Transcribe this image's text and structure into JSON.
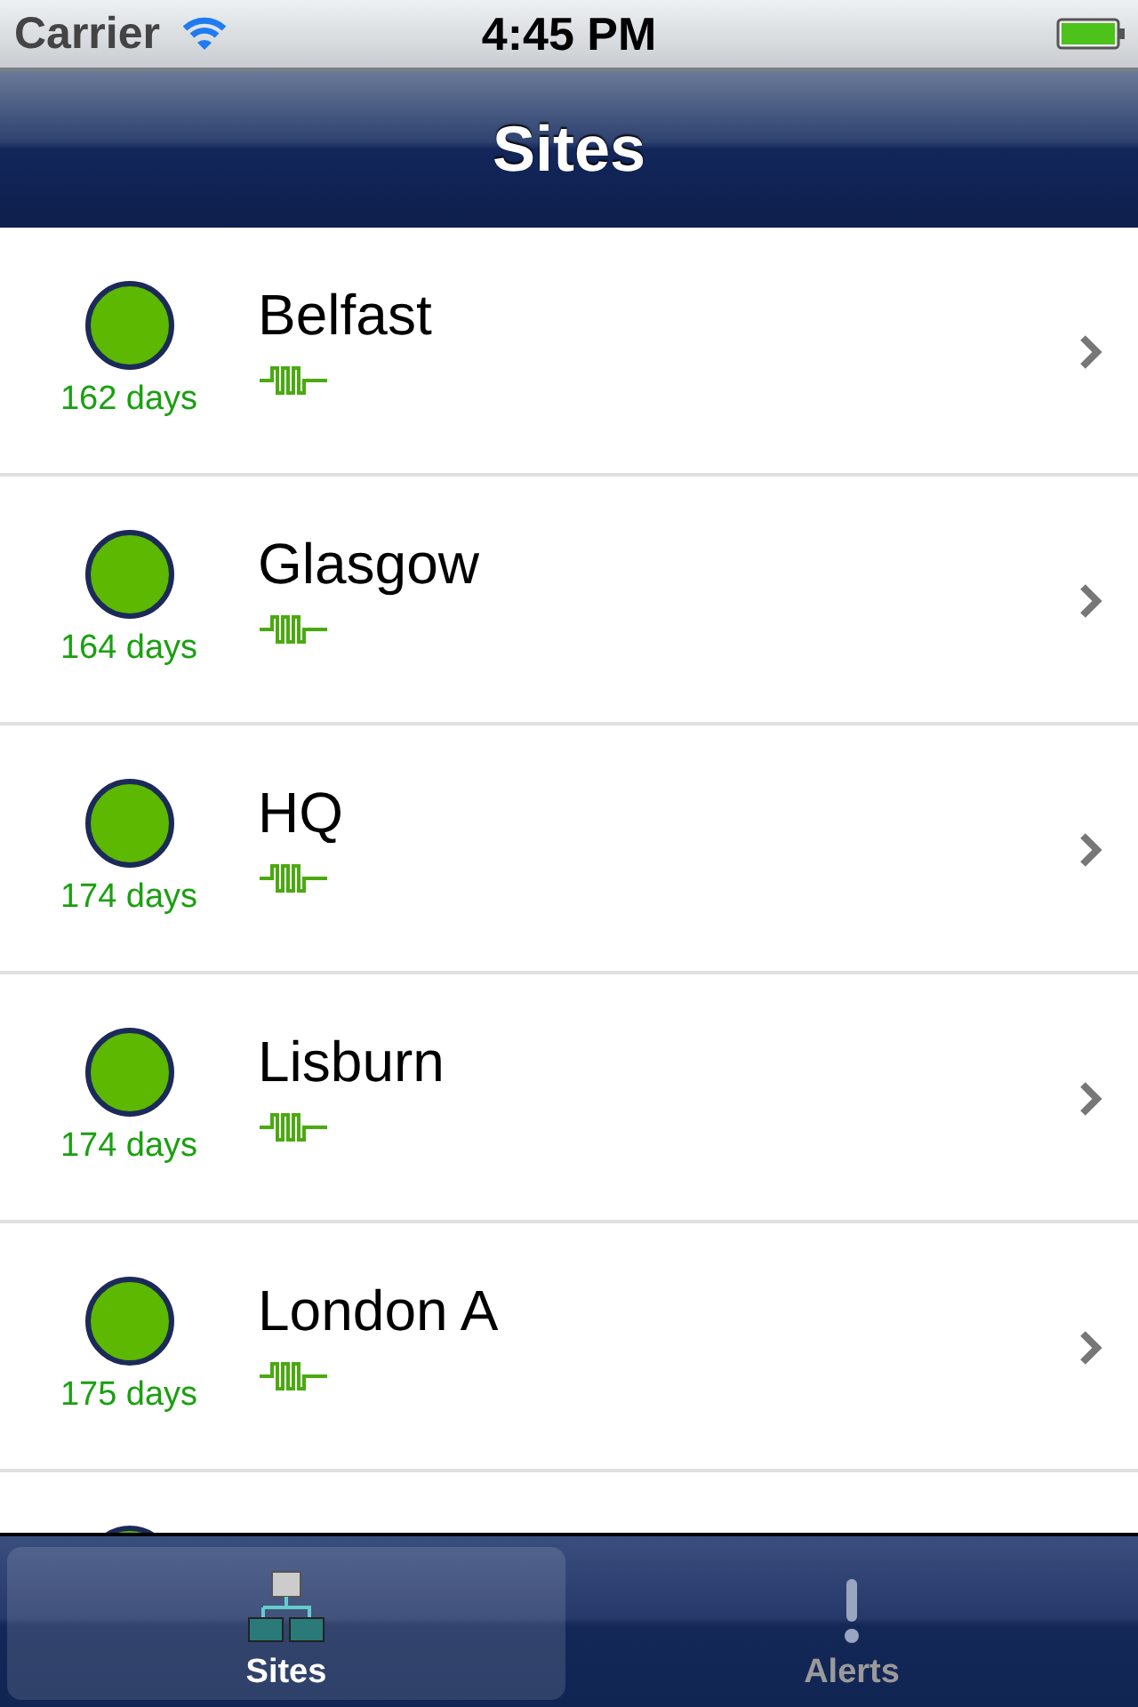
{
  "status_bar": {
    "carrier": "Carrier",
    "time": "4:45 PM"
  },
  "nav_bar": {
    "title": "Sites"
  },
  "sites": [
    {
      "name": "Belfast",
      "uptime": "162 days",
      "color": "#5cb800"
    },
    {
      "name": "Glasgow",
      "uptime": "164 days",
      "color": "#5cb800"
    },
    {
      "name": "HQ",
      "uptime": "174 days",
      "color": "#5cb800"
    },
    {
      "name": "Lisburn",
      "uptime": "174 days",
      "color": "#5cb800"
    },
    {
      "name": "London A",
      "uptime": "175 days",
      "color": "#5cb800"
    },
    {
      "color": "#5cb800"
    }
  ],
  "tabs": [
    {
      "label": "Sites",
      "kind": "sites",
      "selected": true
    },
    {
      "label": "Alerts",
      "kind": "alerts",
      "selected": false
    }
  ]
}
